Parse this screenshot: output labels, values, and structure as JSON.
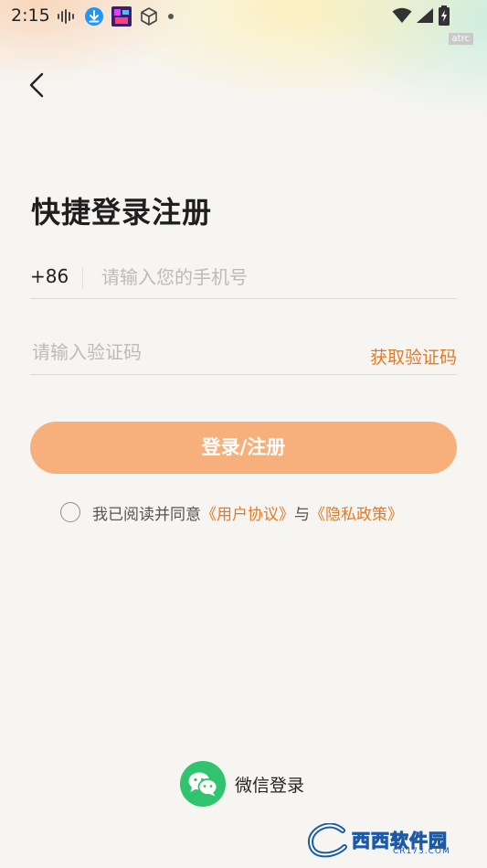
{
  "status_bar": {
    "time": "2:15",
    "tag": "atrc"
  },
  "header": {
    "back_icon": "chevron-left-icon"
  },
  "title": "快捷登录注册",
  "phone": {
    "country_code": "+86",
    "placeholder": "请输入您的手机号",
    "value": ""
  },
  "code": {
    "placeholder": "请输入验证码",
    "value": "",
    "get_code_label": "获取验证码"
  },
  "login_button_label": "登录/注册",
  "agreement": {
    "prefix": "我已阅读并同意",
    "user_agreement": "《用户协议》",
    "connector": "与",
    "privacy_policy": "《隐私政策》",
    "checked": false
  },
  "wechat": {
    "label": "微信登录",
    "icon": "wechat-icon"
  },
  "watermark": {
    "brand": "西西软件园",
    "sub": "CR173.COM"
  },
  "colors": {
    "accent": "#e47a25",
    "button": "#f7b07c",
    "wechat": "#2fc46d",
    "background": "#f7f5f1"
  }
}
